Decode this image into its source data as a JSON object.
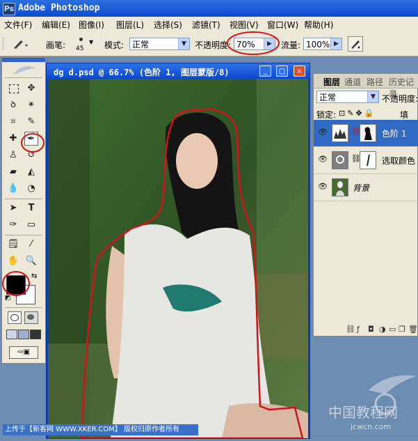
{
  "app": {
    "title": "Adobe Photoshop",
    "logo_text": "Ps"
  },
  "menu": [
    "文件(F)",
    "编辑(E)",
    "图像(I)",
    "图层(L)",
    "选择(S)",
    "滤镜(T)",
    "视图(V)",
    "窗口(W)",
    "帮助(H)"
  ],
  "options": {
    "brush_label": "画笔:",
    "brush_size": "45",
    "mode_label": "模式:",
    "mode_value": "正常",
    "opacity_label": "不透明度:",
    "opacity_value": "70%",
    "flow_label": "流量:",
    "flow_value": "100%"
  },
  "document": {
    "title": "dg d.psd @ 66.7% (色阶 1, 图层蒙版/8)",
    "controls": {
      "minimize": "_",
      "maximize": "□",
      "close": "×"
    }
  },
  "layers_panel": {
    "tabs": [
      "图层",
      "通道",
      "路径",
      "历史记录"
    ],
    "blend_mode": "正常",
    "opacity_label": "不透明度:",
    "lock_label": "锁定:",
    "fill_label": "填充:",
    "layers": [
      {
        "name": "色阶 1",
        "selected": true
      },
      {
        "name": "选取颜色",
        "selected": false
      },
      {
        "name": "背景",
        "selected": false
      }
    ],
    "bottom_icons": [
      "link-icon",
      "fx-icon",
      "mask-icon",
      "adjustment-icon",
      "folder-icon",
      "new-layer-icon",
      "trash-icon"
    ]
  },
  "toolbox": {
    "tools": [
      "marquee-tool",
      "move-tool",
      "lasso-tool",
      "magic-wand-tool",
      "crop-tool",
      "slice-tool",
      "healing-brush-tool",
      "brush-tool",
      "clone-stamp-tool",
      "history-brush-tool",
      "eraser-tool",
      "paint-bucket-tool",
      "blur-tool",
      "dodge-tool",
      "path-selection-tool",
      "type-tool",
      "pen-tool",
      "shape-tool",
      "notes-tool",
      "eyedropper-tool",
      "hand-tool",
      "zoom-tool"
    ],
    "foreground_color": "#000000",
    "background_color": "#ffffff"
  },
  "status": {
    "text": "上传于【新客网 WWW.XKER.COM】 版权归原作者所有"
  },
  "watermark": {
    "text": "中国教程网",
    "url": "jcwcn.com"
  },
  "accent_colors": {
    "title_blue": "#0a48cf",
    "annotation_red": "#d0141b",
    "selected_layer": "#316ac5"
  }
}
